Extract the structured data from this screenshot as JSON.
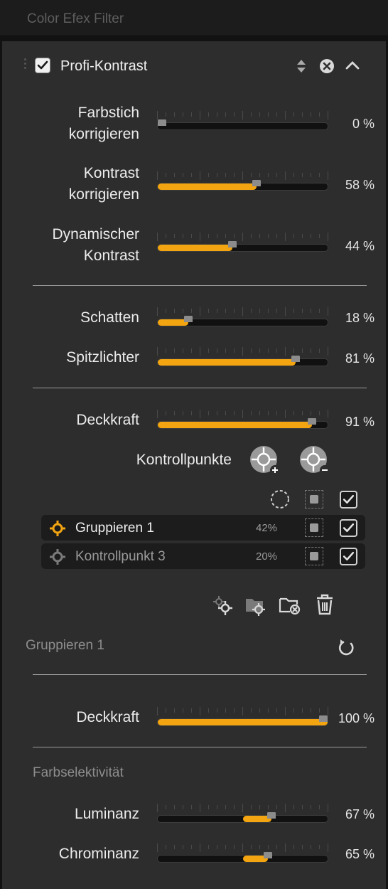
{
  "topbar": {
    "title": "Color Efex Filter"
  },
  "filter": {
    "name": "Profi-Kontrast",
    "enabled": true,
    "icons": {
      "reorder": "up-down-arrows-icon",
      "remove": "close-circle-icon",
      "collapse": "chevron-up-icon"
    }
  },
  "sliders": [
    {
      "id": "farbstich",
      "label_line1": "Farbstich",
      "label_line2": "korrigieren",
      "value": 0,
      "display": "0 %"
    },
    {
      "id": "kontrast",
      "label_line1": "Kontrast",
      "label_line2": "korrigieren",
      "value": 58,
      "display": "58 %"
    },
    {
      "id": "dynamisch",
      "label_line1": "Dynamischer",
      "label_line2": "Kontrast",
      "value": 44,
      "display": "44 %"
    },
    {
      "id": "schatten",
      "label": "Schatten",
      "value": 18,
      "display": "18 %"
    },
    {
      "id": "spitzlichter",
      "label": "Spitzlichter",
      "value": 81,
      "display": "81 %"
    },
    {
      "id": "deckkraft",
      "label": "Deckkraft",
      "value": 91,
      "display": "91 %"
    }
  ],
  "controlpoints": {
    "label": "Kontrollpunkte",
    "add_icon": "add-control-point-icon",
    "remove_icon": "remove-control-point-icon",
    "rows": [
      {
        "name": "Gruppieren 1",
        "value": "42%",
        "active": true,
        "checked": true
      },
      {
        "name": "Kontrollpunkt 3",
        "value": "20%",
        "active": false,
        "checked": true
      }
    ],
    "actions": [
      "duplicate-point-icon",
      "group-points-icon",
      "ungroup-points-icon",
      "trash-icon"
    ]
  },
  "group": {
    "title": "Gruppieren 1",
    "reset_icon": "reset-icon",
    "opacity": {
      "label": "Deckkraft",
      "value": 100,
      "display": "100 %"
    }
  },
  "color_selectivity": {
    "title": "Farbselektivität",
    "luminanz": {
      "label": "Luminanz",
      "value": 67,
      "display": "67 %"
    },
    "chrominanz": {
      "label": "Chrominanz",
      "value": 65,
      "display": "65 %"
    }
  },
  "colors": {
    "accent": "#f3a511",
    "panel": "#2d2d2d",
    "background": "#121212"
  }
}
